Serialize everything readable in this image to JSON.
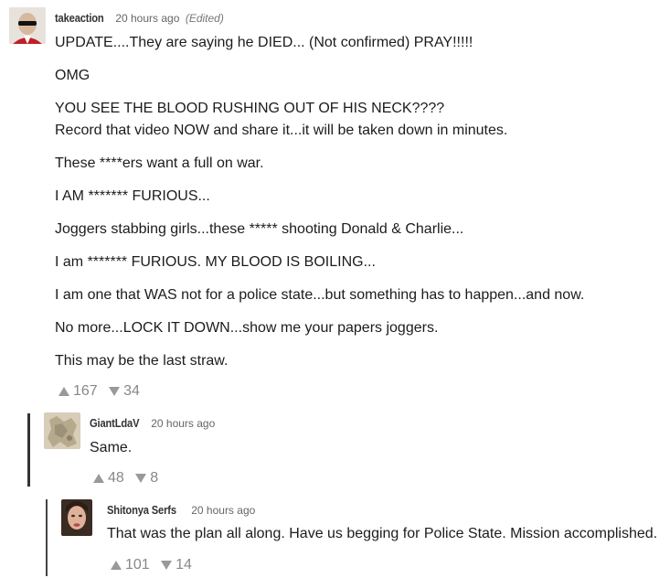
{
  "comments": [
    {
      "author": "takeaction",
      "time": "20 hours ago",
      "edited": "(Edited)",
      "paragraphs": [
        "UPDATE....They are saying he DIED... (Not confirmed)  PRAY!!!!!",
        "OMG",
        "YOU SEE THE BLOOD RUSHING OUT OF HIS NECK????",
        "Record that video NOW and share it...it will be taken down in minutes.",
        "These ****ers want a full on war.",
        "I AM ******* FURIOUS...",
        "Joggers stabbing girls...these ***** shooting Donald & Charlie...",
        "I am ******* FURIOUS. MY BLOOD IS BOILING...",
        "I am one that WAS not for a police state...but something has to happen...and now.",
        "No more...LOCK IT DOWN...show me your papers joggers.",
        "This may be the last straw."
      ],
      "upvotes": "167",
      "downvotes": "34"
    },
    {
      "author": "GiantLdaV",
      "time": "20 hours ago",
      "paragraphs": [
        "Same."
      ],
      "upvotes": "48",
      "downvotes": "8"
    },
    {
      "author": "Shitonya Serfs",
      "time": "20 hours ago",
      "paragraphs": [
        "That was the plan all along. Have us begging for Police State. Mission accomplished."
      ],
      "upvotes": "101",
      "downvotes": "14"
    }
  ]
}
